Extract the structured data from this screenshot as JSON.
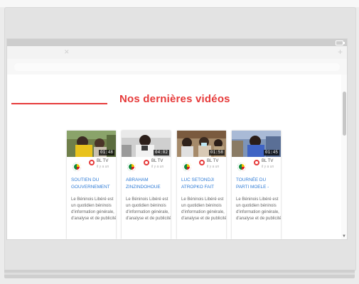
{
  "section_title": "Nos dernières vidéos",
  "colors": {
    "accent": "#e63a3a",
    "link": "#2e7bd6"
  },
  "videos": [
    {
      "duration": "01:48",
      "channel": "BL TV",
      "time_ago": "il y a un",
      "title_line1": "SOUTIEN DU",
      "title_line2": "GOUVERNEMENT",
      "description": "Le Béninois Libéré est un quotidien béninois d'information générale, d'analyse et de publicité"
    },
    {
      "duration": "04:02",
      "channel": "BL TV",
      "time_ago": "il y a un",
      "title_line1": "ABRAHAM",
      "title_line2": "ZINZINDOHOUE",
      "description": "Le Béninois Libéré est un quotidien béninois d'information générale, d'analyse et de publicité"
    },
    {
      "duration": "01:58",
      "channel": "BL TV",
      "time_ago": "il y a un",
      "title_line1": "LUC SETONDJI",
      "title_line2": "ATROPKO FAIT",
      "description": "Le Béninois Libéré est un quotidien béninois d'information générale, d'analyse et de publicité"
    },
    {
      "duration": "01:45",
      "channel": "BL TV",
      "time_ago": "il y a un",
      "title_line1": "TOURNÉE DU",
      "title_line2": "PARTI MOELE -",
      "description": "Le Béninois Libéré est un quotidien béninois d'information générale, d'analyse et de publicité"
    }
  ]
}
